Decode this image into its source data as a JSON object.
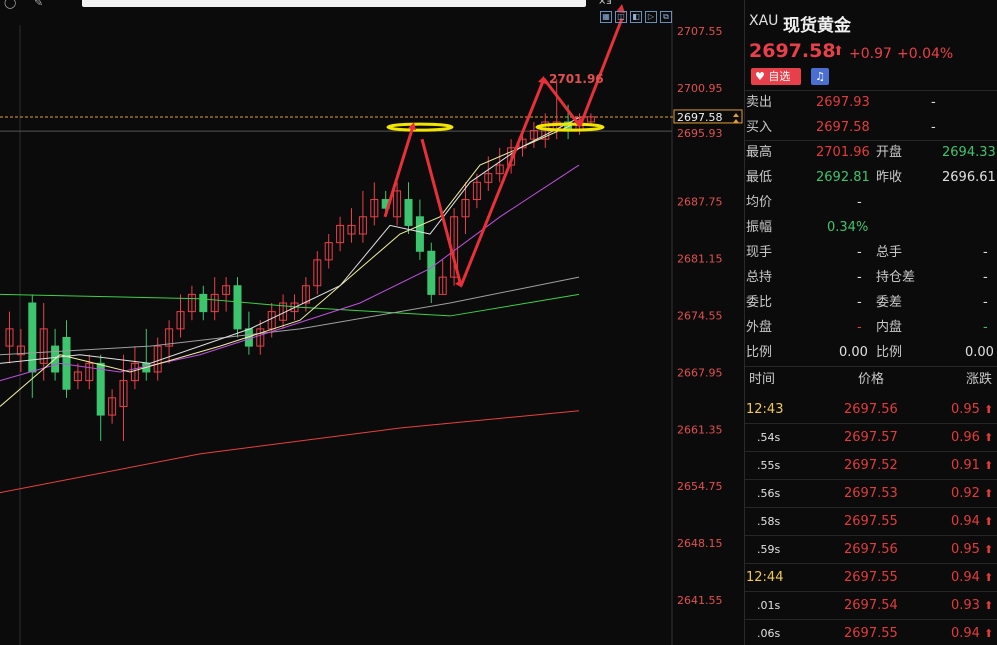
{
  "topbar": {
    "search_icon": "search-icon",
    "pen_icon": "pen-icon",
    "toolbar_glyph": "×ⅎ"
  },
  "chart": {
    "price_labels": [
      "2707.55",
      "2700.95",
      "2697.58",
      "2695.93",
      "2687.75",
      "2681.15",
      "2674.55",
      "2667.95",
      "2661.35",
      "2654.75",
      "2648.15",
      "2641.55"
    ],
    "peak_label": "2701.96",
    "current_price_tag": "2697.58",
    "ask_price_tag": "2695.93"
  },
  "quote": {
    "symbol": "XAU",
    "name": "现货黄金",
    "price": "2697.58",
    "change": "+0.97",
    "change_pct": "+0.04%",
    "fav_label": "自选",
    "sell_label": "卖出",
    "sell_price": "2697.93",
    "sell_dash": "-",
    "buy_label": "买入",
    "buy_price": "2697.58",
    "buy_dash": "-"
  },
  "stats": {
    "high_label": "最高",
    "high": "2701.96",
    "open_label": "开盘",
    "open": "2694.33",
    "low_label": "最低",
    "low": "2692.81",
    "prev_label": "昨收",
    "prev": "2696.61",
    "avg_label": "均价",
    "avg": "-",
    "amp_label": "振幅",
    "amp": "0.34%",
    "cur_hand_label": "现手",
    "cur_hand": "-",
    "total_hand_label": "总手",
    "total_hand": "-",
    "total_hold_label": "总持",
    "total_hold": "-",
    "hold_diff_label": "持仓差",
    "hold_diff": "-",
    "ratio_label": "委比",
    "ratio": "-",
    "order_diff_label": "委差",
    "order_diff": "-",
    "outer_label": "外盘",
    "outer": "-",
    "inner_label": "内盘",
    "inner": "-",
    "bili1_label": "比例",
    "bili1": "0.00",
    "bili2_label": "比例",
    "bili2": "0.00"
  },
  "ticks_header": {
    "time": "时间",
    "price": "价格",
    "change": "涨跌"
  },
  "ticks": [
    {
      "time": "12:43",
      "price": "2697.56",
      "change": "0.95"
    },
    {
      "time": ".54s",
      "price": "2697.57",
      "change": "0.96"
    },
    {
      "time": ".55s",
      "price": "2697.52",
      "change": "0.91"
    },
    {
      "time": ".56s",
      "price": "2697.53",
      "change": "0.92"
    },
    {
      "time": ".58s",
      "price": "2697.55",
      "change": "0.94"
    },
    {
      "time": ".59s",
      "price": "2697.56",
      "change": "0.95"
    },
    {
      "time": "12:44",
      "price": "2697.55",
      "change": "0.94"
    },
    {
      "time": ".01s",
      "price": "2697.54",
      "change": "0.93"
    },
    {
      "time": ".06s",
      "price": "2697.55",
      "change": "0.94"
    }
  ],
  "colors": {
    "up": "#e8404a",
    "down": "#3dc46f",
    "accent": "#f2c94c"
  }
}
